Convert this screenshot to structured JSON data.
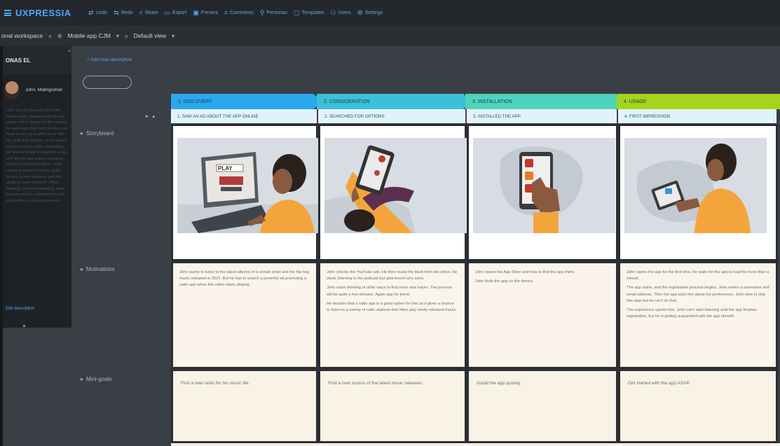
{
  "app": {
    "name": "UXPRESSIA"
  },
  "toolbar": {
    "items": [
      {
        "icon": "arrows-icon",
        "glyph": "⇄",
        "label": "Undo"
      },
      {
        "icon": "arrows-icon",
        "glyph": "⇆",
        "label": "Redo"
      },
      {
        "icon": "share-icon",
        "glyph": "<",
        "label": "Share"
      },
      {
        "icon": "export-icon",
        "glyph": "▭",
        "label": "Export"
      },
      {
        "icon": "present-icon",
        "glyph": "▣",
        "label": "Present"
      },
      {
        "icon": "comments-icon",
        "glyph": "⌗",
        "label": "Comments"
      },
      {
        "icon": "personas-icon",
        "glyph": "⚲",
        "label": "Personas"
      },
      {
        "icon": "templates-icon",
        "glyph": "▢",
        "label": "Templates"
      },
      {
        "icon": "users-icon",
        "glyph": "⚇",
        "label": "Users"
      },
      {
        "icon": "settings-icon",
        "glyph": "⚙",
        "label": "Settings"
      }
    ]
  },
  "breadcrumb": {
    "workspace": "onal workspace",
    "sep1": "»",
    "project_icon": "⊕",
    "project": "Mobile app CJM",
    "caret": "▾",
    "sep2": "»",
    "view": "Default view",
    "view_caret": "▾"
  },
  "persona": {
    "header": "ONAS EL",
    "name": "John, Malingrahan",
    "description": "John is a 28-year-old fan of the latest music releases and hip-hop tracks. He is always on the lookout for new apps that help him discover fresh tunes. He is often busy with his work and studies, so he usually listens to music while commuting. He likes to share his favorite songs with friends and enjoys exploring playlists curated by others. John values a simple interface, quick access to new releases and the ability to save tracks for offline listening. He is frustrated by apps that are slow or cluttered with ads and prefers a clean experience.",
    "edit_link": "Edit description",
    "scroll_up": "▲",
    "collapse": "▲"
  },
  "map": {
    "add_description": "+ Add map description",
    "expand_control": "▸ ▴",
    "rows": [
      {
        "icon": "▸",
        "label": "Storyboard"
      },
      {
        "icon": "▸",
        "label": "Motivations"
      },
      {
        "icon": "▸",
        "label": "Mini-goals"
      }
    ]
  },
  "stages": [
    {
      "title": "1. DISCOVERY",
      "sub": "1. SAW AN AD ABOUT THE APP ONLINE",
      "color": "#2aa8ee",
      "motivations": [
        "John wants to listen to the latest albums of a certain artist and the hip-hop music released in 2022. But he has to search a powerful ad promoting a radio app when this video starts playing."
      ],
      "mini_goal": "Find a new radio for his music life."
    },
    {
      "title": "2. CONSIDERATION",
      "sub": "2. SEARCHED FOR OPTIONS",
      "color": "#3bc0d9",
      "motivations": [
        "John checks the YouTube ads. He then reads the blurb from the video. He starts listening to the podcast but gets bored very soon.",
        "John starts thinking of other ways to find more new tracks. The process will be quite a few minutes. Again app for trend.",
        "He decides that a radio app is a good option for him as it gives a chance to listen to a variety of radio stations that often play newly released tracks."
      ],
      "mini_goal": "Find a new source of the latest music releases."
    },
    {
      "title": "3. INSTALLATION",
      "sub": "3. INSTALLED THE APP",
      "color": "#4fd3bd",
      "motivations": [
        "John opens the App Store and tries to find the app there.",
        "John finds the app on the device."
      ],
      "mini_goal": "Install the app quickly."
    },
    {
      "title": "4. USAGE",
      "sub": "4. FIRST IMPRESSION",
      "color": "#a4d41e",
      "motivations": [
        "John opens the app for the first time. He waits for the app to load for more than a minute.",
        "The app starts, and the registration process begins. John enters a username and email address. Then the app asks him about his preferences. John tries to skip this step but he can't do that.",
        "The experience upsets him. John can't start listening until the app finishes registration, but he is getting acquainted with the app himself."
      ],
      "mini_goal": "Get started with the app ASAP."
    }
  ]
}
